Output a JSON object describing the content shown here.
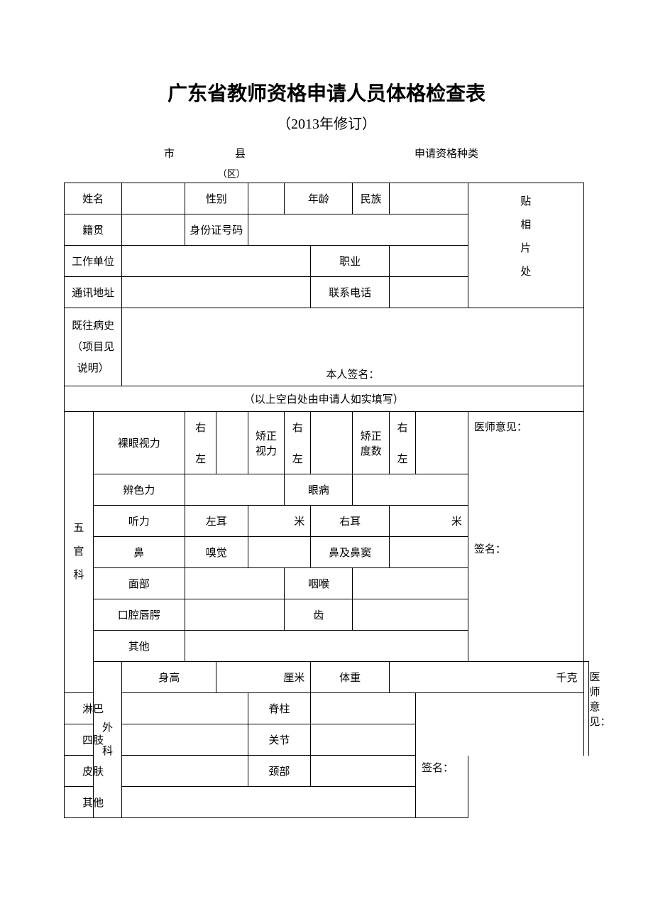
{
  "title": "广东省教师资格申请人员体格检查表",
  "subtitle": "（2013年修订）",
  "header": {
    "city": "市",
    "district": "（区）",
    "county": "县",
    "qualification_type": "申请资格种类"
  },
  "personal": {
    "name": "姓名",
    "gender": "性别",
    "age": "年龄",
    "ethnicity": "民族",
    "native_place": "籍贯",
    "id_number": "身份证号码",
    "work_unit": "工作单位",
    "occupation": "职业",
    "address": "通讯地址",
    "phone": "联系电话",
    "history_l1": "既往病史",
    "history_l2": "（项目见",
    "history_l3": "说明）",
    "signature_label": "本人签名：",
    "photo_l1": "贴",
    "photo_l2": "相",
    "photo_l3": "片",
    "photo_l4": "处"
  },
  "note": "（以上空白处由申请人如实填写）",
  "five_sense": {
    "section": "五\n\n官\n\n科",
    "section_l1": "五",
    "section_l2": "官",
    "section_l3": "科",
    "naked_vision": "裸眼视力",
    "right": "右",
    "left": "左",
    "corrected_l1": "矫正",
    "corrected_l2": "视力",
    "corrected_deg_l1": "矫正",
    "corrected_deg_l2": "度数",
    "color": "辨色力",
    "eye_disease": "眼病",
    "hearing": "听力",
    "left_ear": "左耳",
    "right_ear": "右耳",
    "meter": "米",
    "nose": "鼻",
    "smell": "嗅觉",
    "nasal": "鼻及鼻窦",
    "face": "面部",
    "throat": "咽喉",
    "oral": "口腔唇腭",
    "teeth": "齿",
    "other": "其他",
    "doctor_opinion": "医师意见：",
    "signature": "签名："
  },
  "surgery": {
    "section_l1": "外",
    "section_l2": "科",
    "height": "身高",
    "cm": "厘米",
    "weight": "体重",
    "kg": "千克",
    "lymph": "淋巴",
    "spine": "脊柱",
    "limbs": "四肢",
    "joints": "关节",
    "skin": "皮肤",
    "neck": "颈部",
    "other": "其他",
    "doctor_opinion": "医师意见：",
    "signature": "签名："
  }
}
